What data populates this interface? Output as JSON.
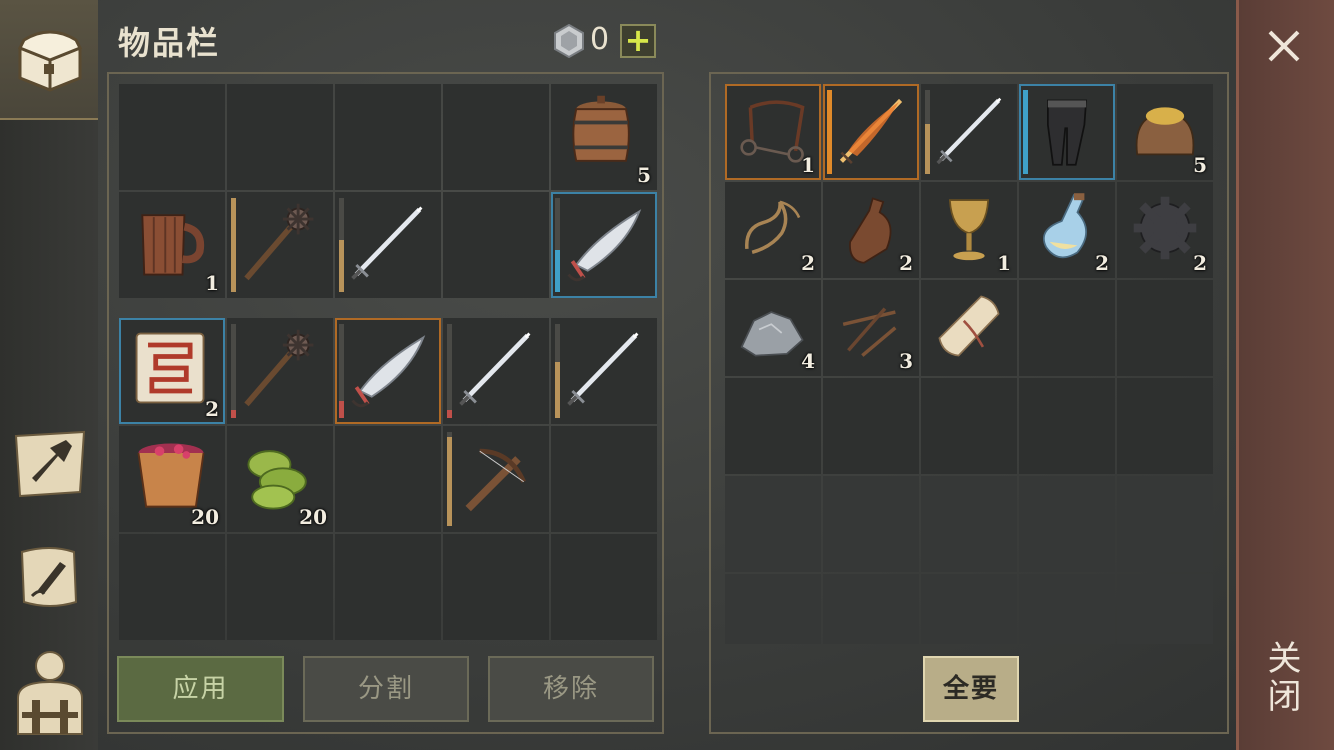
{
  "title": "物品栏",
  "currency": {
    "icon": "silver-coin-icon",
    "value": "0",
    "add_label": "+"
  },
  "tabs": [
    {
      "icon": "chest-icon",
      "active": true
    },
    {
      "icon": "crafting-hammer-icon",
      "active": false
    },
    {
      "icon": "quest-scroll-icon",
      "active": false
    },
    {
      "icon": "character-backpack-icon",
      "active": false
    }
  ],
  "inventory": {
    "upper": [
      {
        "icon": null
      },
      {
        "icon": null
      },
      {
        "icon": null
      },
      {
        "icon": null
      },
      {
        "icon": "barrel-icon",
        "qty": "5"
      },
      {
        "icon": "wooden-mug-icon",
        "qty": "1"
      },
      {
        "icon": "spiked-mace-icon",
        "durability": 1.0,
        "bar_color": "#b8935a"
      },
      {
        "icon": "sword-icon",
        "durability": 0.55,
        "bar_color": "#b8935a"
      },
      {
        "icon": null
      },
      {
        "icon": "scimitar-icon",
        "durability": 0.45,
        "bar_color": "#3fa0c8",
        "frame": "blue"
      }
    ],
    "lower": [
      {
        "icon": "recipe-scroll-icon",
        "qty": "2",
        "frame": "blue"
      },
      {
        "icon": "spiked-mace-icon",
        "durability": 0.08,
        "bar_color": "#c0504a"
      },
      {
        "icon": "scimitar-icon",
        "durability": 0.18,
        "bar_color": "#c0504a",
        "frame": "orange"
      },
      {
        "icon": "sword-icon",
        "durability": 0.08,
        "bar_color": "#c0504a"
      },
      {
        "icon": "sword-icon",
        "durability": 0.6,
        "bar_color": "#b8935a"
      },
      {
        "icon": "berry-bucket-icon",
        "qty": "20"
      },
      {
        "icon": "herbs-icon",
        "qty": "20"
      },
      {
        "icon": null
      },
      {
        "icon": "crossbow-icon",
        "durability": 0.95,
        "bar_color": "#b8935a"
      },
      {
        "icon": null
      },
      {
        "icon": null
      },
      {
        "icon": null
      },
      {
        "icon": null
      },
      {
        "icon": null
      },
      {
        "icon": null
      }
    ]
  },
  "loot": [
    {
      "icon": "horse-bridle-icon",
      "qty": "1",
      "frame": "orange"
    },
    {
      "icon": "flaming-sword-icon",
      "durability": 1.0,
      "bar_color": "#e08a2a",
      "frame": "orange"
    },
    {
      "icon": "sword-icon",
      "durability": 0.6,
      "bar_color": "#b8935a"
    },
    {
      "icon": "chain-leggings-icon",
      "durability": 1.0,
      "bar_color": "#3fa0c8",
      "frame": "blue"
    },
    {
      "icon": "grain-sack-icon",
      "qty": "5"
    },
    {
      "icon": "rope-icon",
      "qty": "2"
    },
    {
      "icon": "leather-bottle-icon",
      "qty": "2"
    },
    {
      "icon": "golden-goblet-icon",
      "qty": "1"
    },
    {
      "icon": "potion-flask-icon",
      "qty": "2"
    },
    {
      "icon": "gear-icon",
      "qty": "2"
    },
    {
      "icon": "iron-ore-icon",
      "qty": "4"
    },
    {
      "icon": "nails-icon",
      "qty": "3"
    },
    {
      "icon": "parchment-roll-icon"
    },
    {
      "icon": null
    },
    {
      "icon": null
    },
    {
      "icon": null
    },
    {
      "icon": null
    },
    {
      "icon": null
    },
    {
      "icon": null
    },
    {
      "icon": null
    },
    {
      "icon": null
    },
    {
      "icon": null
    },
    {
      "icon": null
    },
    {
      "icon": null
    },
    {
      "icon": null
    },
    {
      "icon": null
    },
    {
      "icon": null
    },
    {
      "icon": null
    },
    {
      "icon": null
    },
    {
      "icon": null
    }
  ],
  "buttons": {
    "apply": "应用",
    "split": "分割",
    "remove": "移除",
    "take_all": "全要"
  },
  "close": {
    "icon": "close-icon",
    "label": "关闭"
  },
  "colors": {
    "apply_green": "#5b6a42",
    "close_red": "#6e4a40",
    "accent_tan": "#b8ad88"
  }
}
